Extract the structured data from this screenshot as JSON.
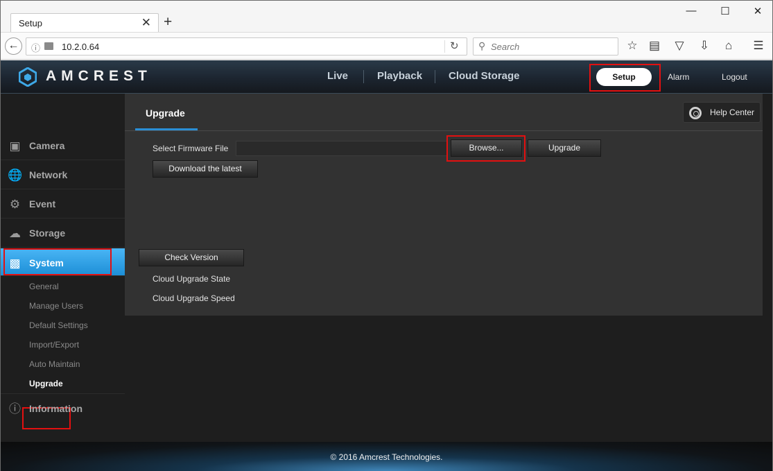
{
  "browser": {
    "tab_title": "Setup",
    "tab_close": "✕",
    "new_tab": "+",
    "url": "10.2.0.64",
    "search_placeholder": "Search",
    "window_controls": {
      "minimize": "—",
      "maximize": "☐",
      "close": "✕"
    }
  },
  "app": {
    "brand": "AMCREST",
    "topnav": [
      "Live",
      "Playback",
      "Cloud Storage"
    ],
    "setup": "Setup",
    "alarm": "Alarm",
    "logout": "Logout",
    "help_center": "Help Center",
    "sidebar": [
      {
        "label": "Camera",
        "icon": "camera-icon"
      },
      {
        "label": "Network",
        "icon": "globe-icon"
      },
      {
        "label": "Event",
        "icon": "alarm-icon"
      },
      {
        "label": "Storage",
        "icon": "cloud-icon"
      },
      {
        "label": "System",
        "icon": "monitor-icon"
      },
      {
        "label": "Information",
        "icon": "info-icon"
      }
    ],
    "system_subitems": [
      "General",
      "Manage Users",
      "Default Settings",
      "Import/Export",
      "Auto Maintain",
      "Upgrade"
    ],
    "content": {
      "tab": "Upgrade",
      "select_firmware_label": "Select Firmware File",
      "browse": "Browse...",
      "upgrade": "Upgrade",
      "download_latest": "Download the latest",
      "check_version": "Check Version",
      "cloud_upgrade_state": "Cloud Upgrade State",
      "cloud_upgrade_speed": "Cloud Upgrade Speed"
    },
    "footer": "© 2016 Amcrest Technologies."
  },
  "colors": {
    "highlight": "#e31010",
    "active_blue": "#1d8fd7"
  }
}
